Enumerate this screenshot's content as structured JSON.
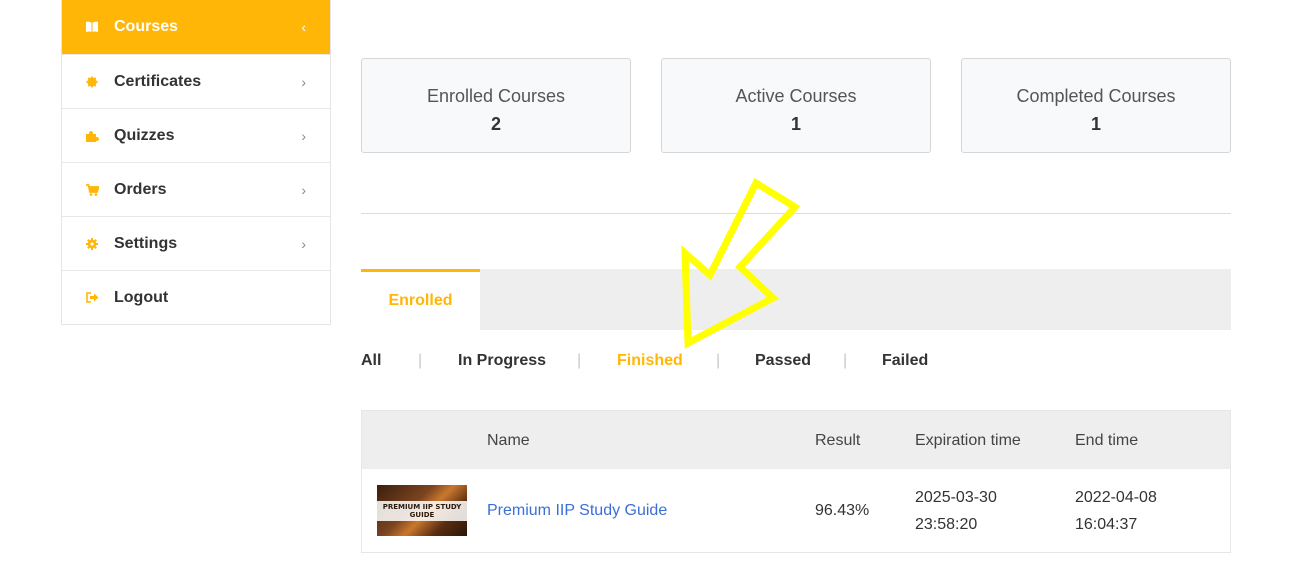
{
  "sidebar": {
    "items": [
      {
        "label": "Courses",
        "icon": "book-icon",
        "active": true
      },
      {
        "label": "Certificates",
        "icon": "certificate-icon",
        "active": false
      },
      {
        "label": "Quizzes",
        "icon": "puzzle-icon",
        "active": false
      },
      {
        "label": "Orders",
        "icon": "cart-icon",
        "active": false
      },
      {
        "label": "Settings",
        "icon": "gear-icon",
        "active": false
      },
      {
        "label": "Logout",
        "icon": "logout-icon",
        "active": false
      }
    ]
  },
  "stats": [
    {
      "label": "Enrolled Courses",
      "value": "2"
    },
    {
      "label": "Active Courses",
      "value": "1"
    },
    {
      "label": "Completed Courses",
      "value": "1"
    }
  ],
  "tabs": {
    "enrolled": "Enrolled"
  },
  "filters": {
    "items": [
      "All",
      "In Progress",
      "Finished",
      "Passed",
      "Failed"
    ],
    "active": "Finished",
    "separator": "|"
  },
  "table": {
    "headers": {
      "name": "Name",
      "result": "Result",
      "expiration": "Expiration time",
      "end": "End time"
    },
    "rows": [
      {
        "thumbnail_text": "PREMIUM IIP STUDY GUIDE",
        "name": "Premium IIP Study Guide",
        "result": "96.43%",
        "expiration_date": "2025-03-30",
        "expiration_time": "23:58:20",
        "end_date": "2022-04-08",
        "end_time": "16:04:37"
      }
    ]
  },
  "colors": {
    "accent": "#ffb606",
    "link": "#3a6fd8",
    "annotation_arrow": "#ffff00"
  }
}
